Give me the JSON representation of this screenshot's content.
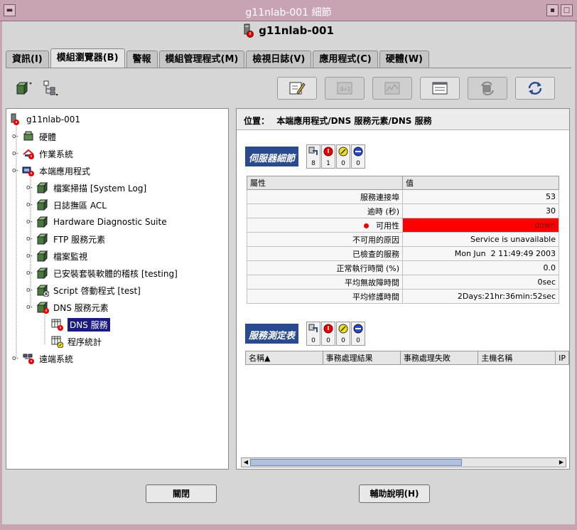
{
  "window": {
    "title": "g11nlab-001 細節",
    "host": "g11nlab-001"
  },
  "tabs": [
    "資訊(I)",
    "模組瀏覽器(B)",
    "警報",
    "模組管理程式(M)",
    "檢視日誌(V)",
    "應用程式(C)",
    "硬體(W)"
  ],
  "active_tab": 1,
  "tree": {
    "root": "g11nlab-001",
    "items": [
      {
        "label": "硬體"
      },
      {
        "label": "作業系統"
      },
      {
        "label": "本端應用程式"
      },
      {
        "label": "檔案掃描 [System Log]"
      },
      {
        "label": "日誌撫區 ACL"
      },
      {
        "label": "Hardware Diagnostic Suite"
      },
      {
        "label": "FTP 服務元素"
      },
      {
        "label": "檔案監視"
      },
      {
        "label": "已安裝套裝軟體的稽核 [testing]"
      },
      {
        "label": "Script 啓動程式 [test]"
      },
      {
        "label": "DNS 服務元素"
      },
      {
        "label": "DNS 服務"
      },
      {
        "label": "程序統計"
      },
      {
        "label": "遠端系統"
      }
    ]
  },
  "location": {
    "label": "位置：",
    "path": "本端應用程式/DNS 服務元素/DNS 服務"
  },
  "server_details": {
    "title": "伺服器細節",
    "counts": [
      "8",
      "1",
      "0",
      "0"
    ],
    "col_attr": "屬性",
    "col_val": "值",
    "rows": [
      {
        "attr": "服務連接埠",
        "val": "53"
      },
      {
        "attr": "逾時 (秒)",
        "val": "30"
      },
      {
        "attr": "可用性",
        "val": "down"
      },
      {
        "attr": "不可用的原因",
        "val": "Service is unavailable"
      },
      {
        "attr": "已檢查的服務",
        "val": "Mon Jun  2 11:49:49 2003"
      },
      {
        "attr": "正常執行時間 (%)",
        "val": "0.0"
      },
      {
        "attr": "平均無故障時間",
        "val": "0sec"
      },
      {
        "attr": "平均修護時間",
        "val": "2Days:21hr:36min:52sec"
      }
    ]
  },
  "service_table": {
    "title": "服務測定表",
    "counts": [
      "0",
      "0",
      "0",
      "0"
    ],
    "columns": [
      "名稱▲",
      "事務處理結果",
      "事務處理失敗",
      "主機名稱",
      "IP"
    ]
  },
  "buttons": {
    "close": "關閉",
    "help": "輔助說明(H)"
  },
  "colors": {
    "title_bar": "#c8a4b2",
    "section": "#2a4a90",
    "alert_red": "#ff0000",
    "selection": "#1a1a80"
  }
}
